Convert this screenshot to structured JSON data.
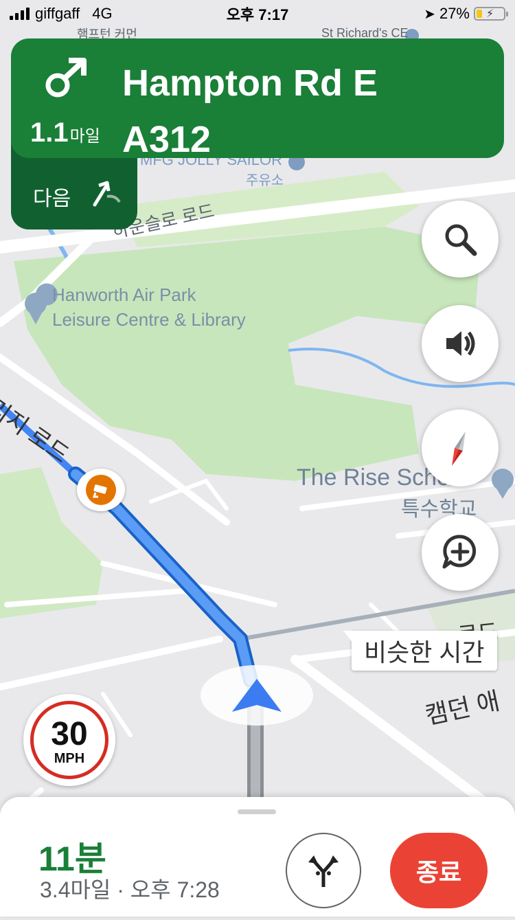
{
  "status_bar": {
    "carrier": "giffgaff",
    "network": "4G",
    "time": "오후 7:17",
    "battery_percent": "27%"
  },
  "navigation": {
    "street_name": "Hampton Rd E",
    "road_number": "A312",
    "distance_value": "1.1",
    "distance_unit": "마일",
    "next_label": "다음",
    "banner_color": "#1a7f37"
  },
  "map": {
    "labels": {
      "top_left_partial": "햄프턴 커먼",
      "top_right_partial": "St Richard's CE",
      "fuel_name": "MFG JOLLY SAILOR",
      "fuel_korean": "주유소",
      "road_hounslow": "하운슬로 로드",
      "park_line1": "Hanworth Air Park",
      "park_line2": "Leisure Centre & Library",
      "road_left": "리지 로드",
      "school_en": "The Rise School",
      "school_ko": "특수학교",
      "road_camden": "캠던 애",
      "road_right": "로드"
    },
    "route_color": "#4285f4"
  },
  "speed_limit": {
    "value": "30",
    "unit": "MPH"
  },
  "traffic_tag": "비슷한 시간",
  "bottom_sheet": {
    "eta_duration": "11분",
    "details": "3.4마일 · 오후 7:28",
    "exit_label": "종료",
    "exit_color": "#ea4335"
  },
  "icons": {
    "turn": "slight-right-turn-icon",
    "next": "slight-right-next-icon",
    "search": "search-icon",
    "sound": "volume-icon",
    "compass": "compass-icon",
    "report": "add-report-icon",
    "alternate_routes": "alternate-routes-icon",
    "speed_camera": "speed-camera-icon"
  }
}
